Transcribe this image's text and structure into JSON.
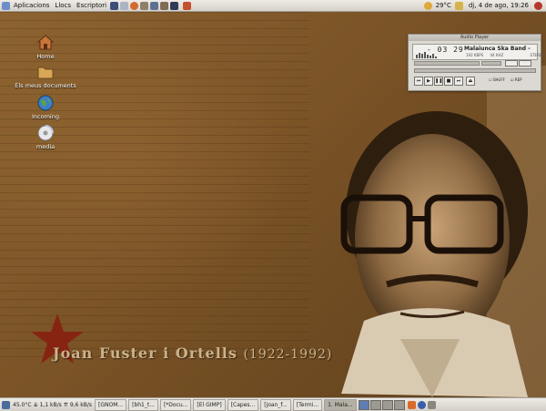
{
  "top_panel": {
    "menus": [
      "Aplicacions",
      "Llocs",
      "Escriptori"
    ],
    "weather": "29°C",
    "clock": "dj,  4 de ago, 19:26"
  },
  "desktop_icons": [
    {
      "label": "Home",
      "icon": "home-folder-icon"
    },
    {
      "label": "Els meus documents",
      "icon": "folder-icon"
    },
    {
      "label": "Incoming",
      "icon": "globe-icon"
    },
    {
      "label": "media",
      "icon": "cd-icon"
    }
  ],
  "audio_player": {
    "title": "Audio Player",
    "time": "- 03 29",
    "song": "Malaiunca Ska Band -",
    "bitrate": "192 KBPS",
    "samplerate": "44 KHZ",
    "mode": "STEREO",
    "shuffle_label": "SHUFF",
    "repeat_label": "REP"
  },
  "caption": {
    "name": "Joan Fuster i Ortells",
    "years": "(1922-1992)"
  },
  "bottom_panel": {
    "cpu_temp": "45.0°C",
    "download": "1,1 kB/s",
    "upload": "9,6 kB/s",
    "tasks": [
      "[GNOM...",
      "[bh1_t...",
      "[*Docu...",
      "[El GIMP]",
      "[Capes...",
      "[joan_f...",
      "[Termi...",
      "1. Mala..."
    ]
  },
  "colors": {
    "caption_star": "#8a1c0e",
    "workspace_active": "#5f7db2"
  }
}
